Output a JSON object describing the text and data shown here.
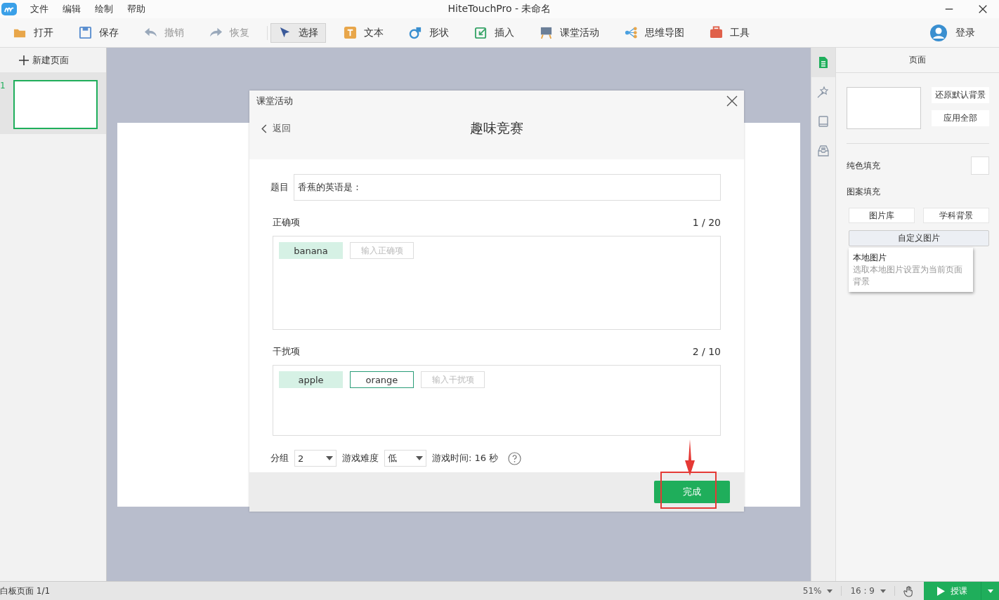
{
  "window": {
    "title": "HiteTouchPro - 未命名",
    "menu": [
      "文件",
      "编辑",
      "绘制",
      "帮助"
    ]
  },
  "toolbar": {
    "items": [
      {
        "kind": "open",
        "label": "打开",
        "disabled": false,
        "selected": false
      },
      {
        "kind": "save",
        "label": "保存",
        "disabled": false,
        "selected": false
      },
      {
        "kind": "undo",
        "label": "撤销",
        "disabled": true,
        "selected": false
      },
      {
        "kind": "redo",
        "label": "恢复",
        "disabled": true,
        "selected": false
      },
      {
        "kind": "select",
        "label": "选择",
        "disabled": false,
        "selected": true
      },
      {
        "kind": "text",
        "label": "文本",
        "disabled": false,
        "selected": false
      },
      {
        "kind": "shape",
        "label": "形状",
        "disabled": false,
        "selected": false
      },
      {
        "kind": "insert",
        "label": "插入",
        "disabled": false,
        "selected": false
      },
      {
        "kind": "activity",
        "label": "课堂活动",
        "disabled": false,
        "selected": false
      },
      {
        "kind": "mindmap",
        "label": "思维导图",
        "disabled": false,
        "selected": false
      },
      {
        "kind": "tools",
        "label": "工具",
        "disabled": false,
        "selected": false
      }
    ],
    "login": "登录"
  },
  "left_panel": {
    "new_page": "新建页面",
    "pages": [
      {
        "number": "1",
        "selected": true
      }
    ]
  },
  "right_panel": {
    "tabs": [
      {
        "kind": "page",
        "selected": true
      },
      {
        "kind": "magic",
        "selected": false
      },
      {
        "kind": "book",
        "selected": false
      },
      {
        "kind": "tray",
        "selected": false
      }
    ],
    "title": "页面",
    "restore_button": "还原默认背景",
    "apply_all_button": "应用全部",
    "solid_fill": "纯色填充",
    "pattern_fill": "图案填充",
    "gallery_button": "图片库",
    "subject_button": "学科背景",
    "custom_button": "自定义图片",
    "tooltip": {
      "title": "本地图片",
      "description": "选取本地图片设置为当前页面背景"
    }
  },
  "dialog": {
    "title": "课堂活动",
    "back": "返回",
    "heading": "趣味竞赛",
    "question_label": "题目",
    "question_value": "香蕉的英语是：",
    "correct": {
      "label": "正确项",
      "count": "1 / 20",
      "items": [
        {
          "text": "banana",
          "selected": false
        }
      ],
      "placeholder": "输入正确项"
    },
    "distractors": {
      "label": "干扰项",
      "count": "2 / 10",
      "items": [
        {
          "text": "apple",
          "selected": false
        },
        {
          "text": "orange",
          "selected": true
        }
      ],
      "placeholder": "输入干扰项"
    },
    "groups_label": "分组",
    "groups_value": "2",
    "difficulty_label": "游戏难度",
    "difficulty_value": "低",
    "time": "游戏时间: 16 秒",
    "done_button": "完成"
  },
  "status_bar": {
    "page_info": "白板页面 1/1",
    "zoom": "51%",
    "ratio": "16 : 9",
    "present_button": "授课"
  }
}
